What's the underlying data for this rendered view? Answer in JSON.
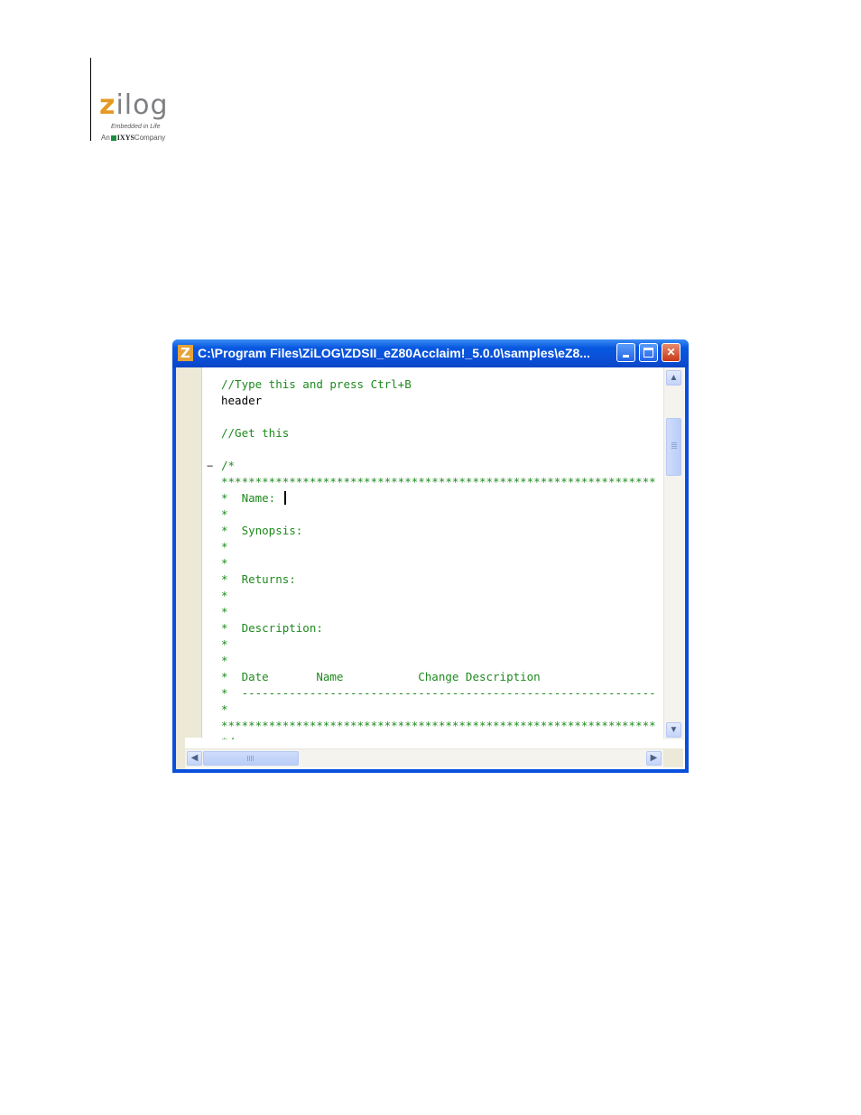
{
  "logo": {
    "wordmark_z": "z",
    "wordmark_rest": "ilog",
    "tagline": "Embedded in Life",
    "company_prefix": "An",
    "company_name": "IXYS",
    "company_suffix": "Company",
    "colors": {
      "z": "#e49a24",
      "text": "#7d7f82",
      "square": "#1b8f3f"
    }
  },
  "window": {
    "app_icon": "Z",
    "title": "C:\\Program Files\\ZiLOG\\ZDSII_eZ80Acclaim!_5.0.0\\samples\\eZ8...",
    "buttons": {
      "minimize": "minimize-icon",
      "maximize": "maximize-icon",
      "close": "✕"
    }
  },
  "editor": {
    "fold_marker": "−",
    "lines": [
      {
        "text": "//Type this and press Ctrl+B",
        "color": "comment"
      },
      {
        "text": "header",
        "color": "plain"
      },
      {
        "text": "",
        "color": "plain"
      },
      {
        "text": "//Get this",
        "color": "comment"
      },
      {
        "text": "",
        "color": "plain"
      },
      {
        "text": "/*",
        "color": "comment"
      },
      {
        "text": "****************************************************************",
        "color": "comment"
      },
      {
        "text": "*  Name: ",
        "color": "comment",
        "caret": true
      },
      {
        "text": "*",
        "color": "comment"
      },
      {
        "text": "*  Synopsis:",
        "color": "comment"
      },
      {
        "text": "*",
        "color": "comment"
      },
      {
        "text": "*",
        "color": "comment"
      },
      {
        "text": "*  Returns:",
        "color": "comment"
      },
      {
        "text": "*",
        "color": "comment"
      },
      {
        "text": "*",
        "color": "comment"
      },
      {
        "text": "*  Description:",
        "color": "comment"
      },
      {
        "text": "*",
        "color": "comment"
      },
      {
        "text": "*",
        "color": "comment"
      },
      {
        "text": "*  Date       Name           Change Description",
        "color": "comment"
      },
      {
        "text": "*  -------------------------------------------------------------",
        "color": "comment"
      },
      {
        "text": "*",
        "color": "comment"
      },
      {
        "text": "****************************************************************",
        "color": "comment"
      },
      {
        "text": "*/",
        "color": "comment"
      }
    ],
    "colors": {
      "comment": "#1e8a1e",
      "plain": "#000000"
    }
  },
  "scrollbars": {
    "up": "▲",
    "down": "▼",
    "left": "◀",
    "right": "▶"
  }
}
